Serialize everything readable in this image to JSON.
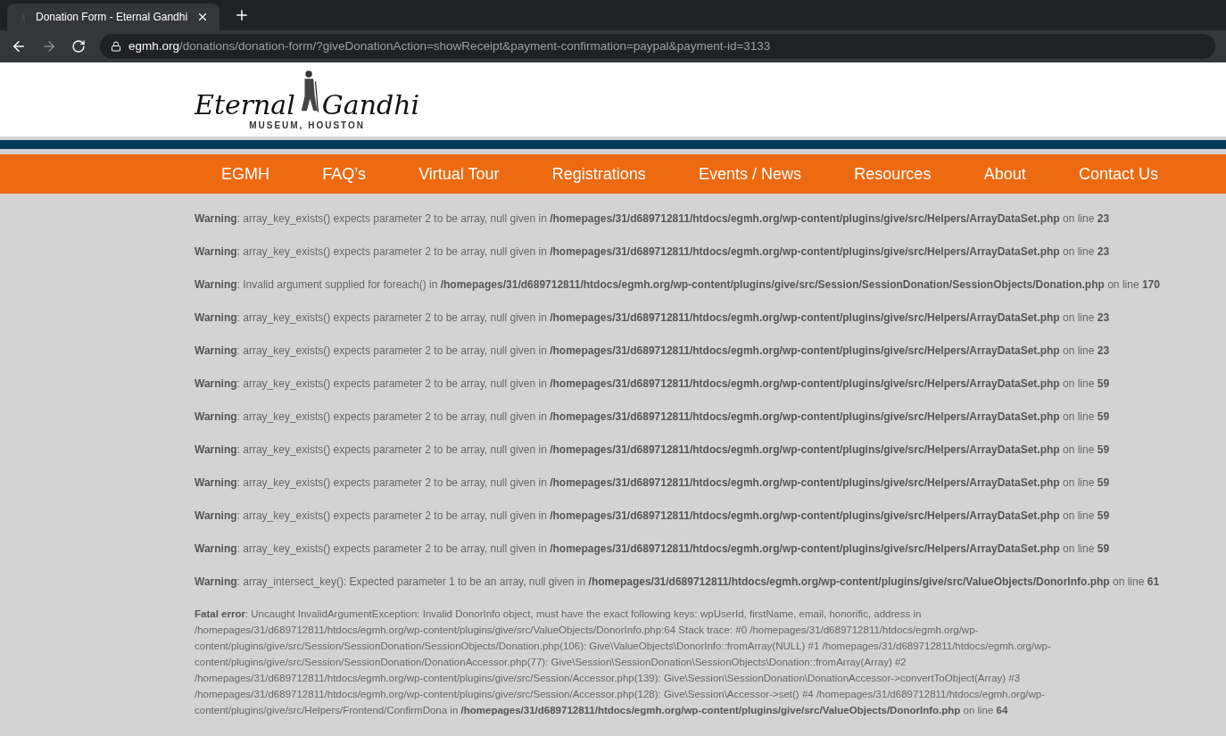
{
  "browser": {
    "tab_title": "Donation Form - Eternal Gandhi",
    "url_host": "egmh.org",
    "url_path": "/donations/donation-form/?giveDonationAction=showReceipt&payment-confirmation=paypal&payment-id=3133"
  },
  "logo": {
    "word_1": "Eternal",
    "word_2": "Gandhi",
    "subtitle": "MUSEUM, HOUSTON"
  },
  "nav": [
    "EGMH",
    "FAQ’s",
    "Virtual Tour",
    "Registrations",
    "Events / News",
    "Resources",
    "About",
    "Contact Us"
  ],
  "messages": [
    "**Warning**: array_key_exists() expects parameter 2 to be array, null given in **/homepages/31/d689712811/htdocs/egmh.org/wp-content/plugins/give/src/Helpers/ArrayDataSet.php** on line **23**",
    "**Warning**: array_key_exists() expects parameter 2 to be array, null given in **/homepages/31/d689712811/htdocs/egmh.org/wp-content/plugins/give/src/Helpers/ArrayDataSet.php** on line **23**",
    "**Warning**: Invalid argument supplied for foreach() in **/homepages/31/d689712811/htdocs/egmh.org/wp-content/plugins/give/src/Session/SessionDonation/SessionObjects/Donation.php** on line **170**",
    "**Warning**: array_key_exists() expects parameter 2 to be array, null given in **/homepages/31/d689712811/htdocs/egmh.org/wp-content/plugins/give/src/Helpers/ArrayDataSet.php** on line **23**",
    "**Warning**: array_key_exists() expects parameter 2 to be array, null given in **/homepages/31/d689712811/htdocs/egmh.org/wp-content/plugins/give/src/Helpers/ArrayDataSet.php** on line **23**",
    "**Warning**: array_key_exists() expects parameter 2 to be array, null given in **/homepages/31/d689712811/htdocs/egmh.org/wp-content/plugins/give/src/Helpers/ArrayDataSet.php** on line **59**",
    "**Warning**: array_key_exists() expects parameter 2 to be array, null given in **/homepages/31/d689712811/htdocs/egmh.org/wp-content/plugins/give/src/Helpers/ArrayDataSet.php** on line **59**",
    "**Warning**: array_key_exists() expects parameter 2 to be array, null given in **/homepages/31/d689712811/htdocs/egmh.org/wp-content/plugins/give/src/Helpers/ArrayDataSet.php** on line **59**",
    "**Warning**: array_key_exists() expects parameter 2 to be array, null given in **/homepages/31/d689712811/htdocs/egmh.org/wp-content/plugins/give/src/Helpers/ArrayDataSet.php** on line **59**",
    "**Warning**: array_key_exists() expects parameter 2 to be array, null given in **/homepages/31/d689712811/htdocs/egmh.org/wp-content/plugins/give/src/Helpers/ArrayDataSet.php** on line **59**",
    "**Warning**: array_key_exists() expects parameter 2 to be array, null given in **/homepages/31/d689712811/htdocs/egmh.org/wp-content/plugins/give/src/Helpers/ArrayDataSet.php** on line **59**",
    "**Warning**: array_intersect_key(): Expected parameter 1 to be an array, null given in **/homepages/31/d689712811/htdocs/egmh.org/wp-content/plugins/give/src/ValueObjects/DonorInfo.php** on line **61**"
  ],
  "fatal_error": "**Fatal error**: Uncaught InvalidArgumentException: Invalid DonorInfo object, must have the exact following keys: wpUserId, firstName, email, honorific, address in /homepages/31/d689712811/htdocs/egmh.org/wp-content/plugins/give/src/ValueObjects/DonorInfo.php:64 Stack trace: #0 /homepages/31/d689712811/htdocs/egmh.org/wp-content/plugins/give/src/Session/SessionDonation/SessionObjects/Donation.php(106): Give\\ValueObjects\\DonorInfo::fromArray(NULL) #1 /homepages/31/d689712811/htdocs/egmh.org/wp-content/plugins/give/src/Session/SessionDonation/DonationAccessor.php(77): Give\\Session\\SessionDonation\\SessionObjects\\Donation::fromArray(Array) #2 /homepages/31/d689712811/htdocs/egmh.org/wp-content/plugins/give/src/Session/Accessor.php(139): Give\\Session\\SessionDonation\\DonationAccessor->convertToObject(Array) #3 /homepages/31/d689712811/htdocs/egmh.org/wp-content/plugins/give/src/Session/Accessor.php(128): Give\\Session\\Accessor->set() #4 /homepages/31/d689712811/htdocs/egmh.org/wp-content/plugins/give/src/Helpers/Frontend/ConfirmDona in **/homepages/31/d689712811/htdocs/egmh.org/wp-content/plugins/give/src/ValueObjects/DonorInfo.php** on line **64**"
}
